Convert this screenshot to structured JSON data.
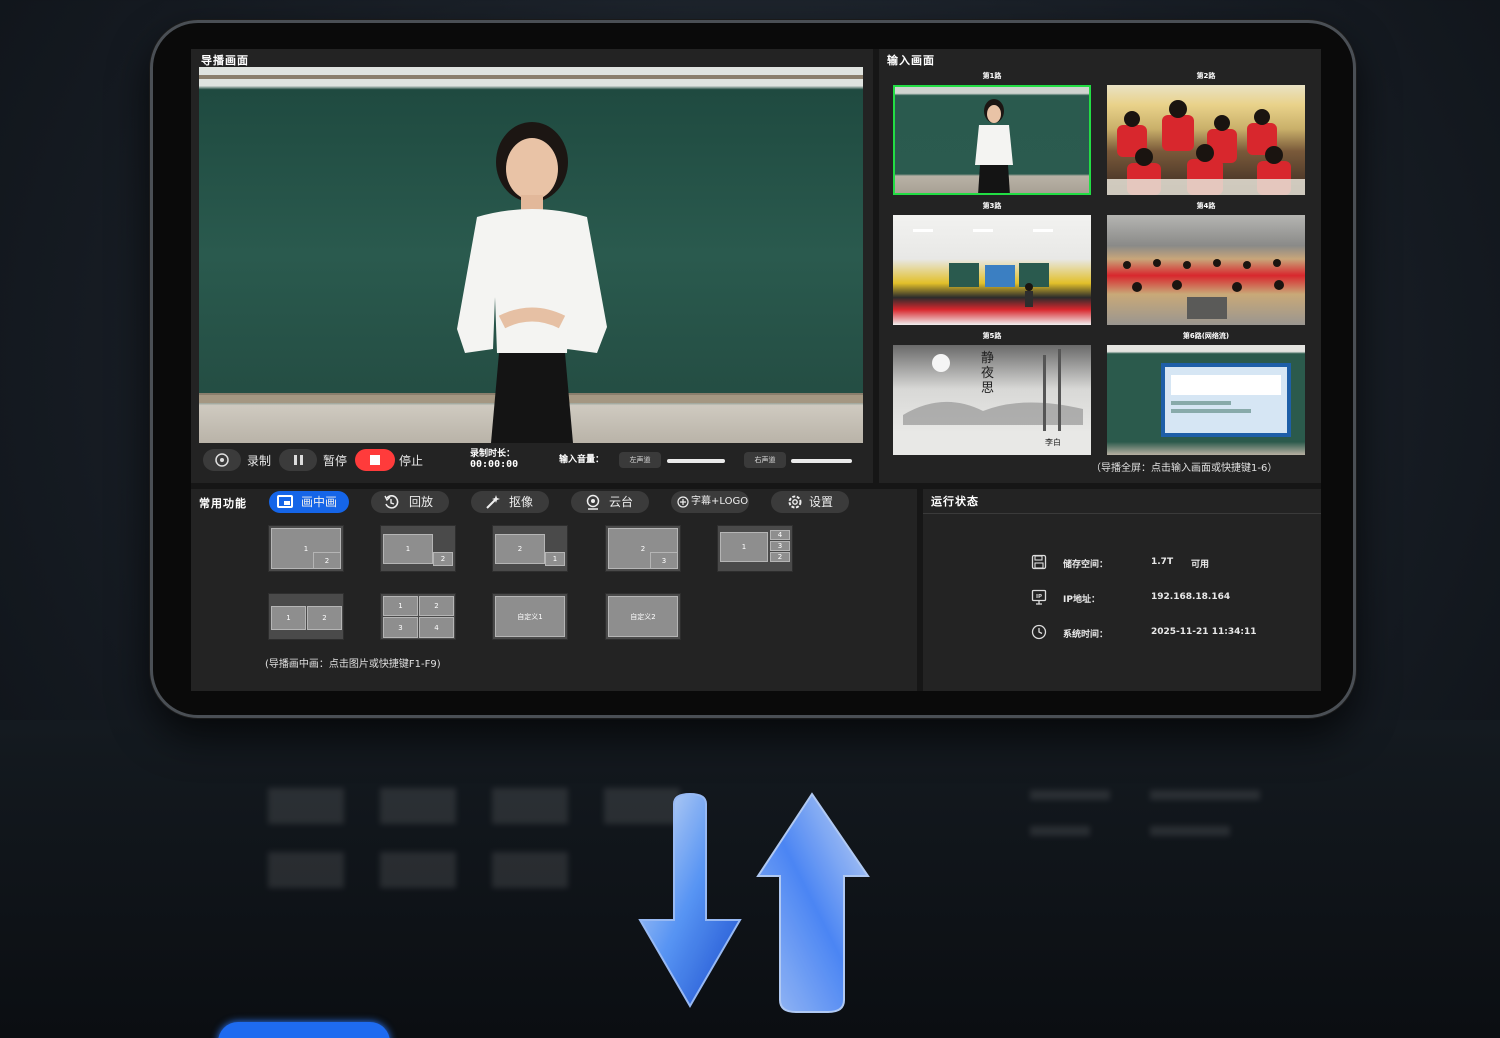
{
  "monitor": {
    "title": "导播画面",
    "record_label": "录制",
    "pause_label": "暂停",
    "stop_label": "停止",
    "duration_label": "录制时长：",
    "duration_value": "00:00:00",
    "volume_label": "输入音量：",
    "left_channel": "左声道",
    "right_channel": "右声道",
    "left_volume": 0.8,
    "right_volume": 0.85
  },
  "inputs": {
    "title": "输入画面",
    "tiles": [
      "第1路",
      "第2路",
      "第3路",
      "第4路",
      "第5路",
      "第6路(网络流)"
    ],
    "selected": "第1路",
    "poem_title": "静夜思",
    "poem_author": "李白",
    "hint": "（导播全屏：点击输入画面或快捷键1-6）"
  },
  "functions": {
    "title": "常用功能",
    "tabs": [
      "画中画",
      "回放",
      "抠像",
      "云台",
      "字幕+LOGO",
      "设置"
    ],
    "active_tab": "画中画",
    "layouts": [
      [
        "1",
        "2"
      ],
      [
        "1",
        "2"
      ],
      [
        "2",
        "1"
      ],
      [
        "2",
        "3"
      ],
      [
        "1",
        "4",
        "3",
        "2"
      ],
      [
        "1",
        "2"
      ],
      [
        "1",
        "2",
        "3",
        "4"
      ],
      [
        "自定义1"
      ],
      [
        "自定义2"
      ]
    ],
    "hint": "(导播画中画：点击图片或快捷键F1-F9)"
  },
  "status": {
    "title": "运行状态",
    "storage_label": "储存空间：",
    "storage_value": "1.7T",
    "storage_suffix": "可用",
    "ip_label": "IP地址：",
    "ip_value": "192.168.18.164",
    "time_label": "系统时间：",
    "time_value": "2025-11-21 11:34:11"
  },
  "colors": {
    "accent": "#1565e8",
    "stop": "#ff3b3b",
    "selected_border": "#22dd44",
    "panel": "#232323"
  }
}
